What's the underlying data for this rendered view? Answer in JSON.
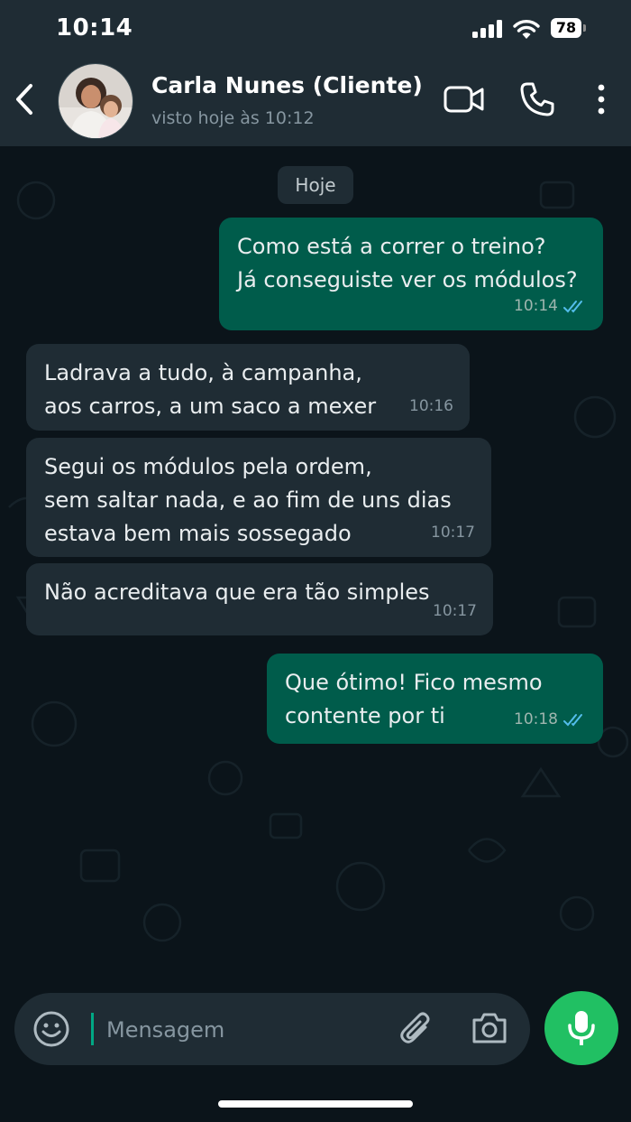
{
  "status_bar": {
    "time": "10:14",
    "battery": "78"
  },
  "header": {
    "contact_name": "Carla Nunes (Cliente)",
    "contact_status": "visto hoje às 10:12"
  },
  "chat": {
    "date_chip": "Hoje",
    "messages": [
      {
        "direction": "out",
        "text": "Como está a correr o treino?\nJá conseguiste ver os módulos?",
        "time": "10:14",
        "status": "read"
      },
      {
        "direction": "in",
        "text": "Ladrava a tudo, à campanha,\naos carros, a um saco a mexer",
        "time": "10:16"
      },
      {
        "direction": "in",
        "text": "Segui os módulos pela ordem,\nsem saltar nada, e ao fim de uns dias\nestava bem mais sossegado",
        "time": "10:17"
      },
      {
        "direction": "in",
        "text": "Não acreditava que era tão simples",
        "time": "10:17"
      },
      {
        "direction": "out",
        "text": "Que ótimo! Fico mesmo\ncontente por ti",
        "time": "10:18",
        "status": "read"
      }
    ]
  },
  "composer": {
    "placeholder": "Mensagem"
  },
  "icons": {
    "back": "chevron-left-icon",
    "video": "video-call-icon",
    "call": "phone-icon",
    "menu": "more-vertical-icon",
    "emoji": "emoji-icon",
    "attach": "paperclip-icon",
    "camera": "camera-icon",
    "mic": "microphone-icon"
  },
  "colors": {
    "header_bg": "#1f2c34",
    "chat_bg": "#0b141a",
    "outgoing_bubble": "#005c4b",
    "incoming_bubble": "#1f2c34",
    "read_ticks": "#53bdeb",
    "accent": "#21c063"
  }
}
